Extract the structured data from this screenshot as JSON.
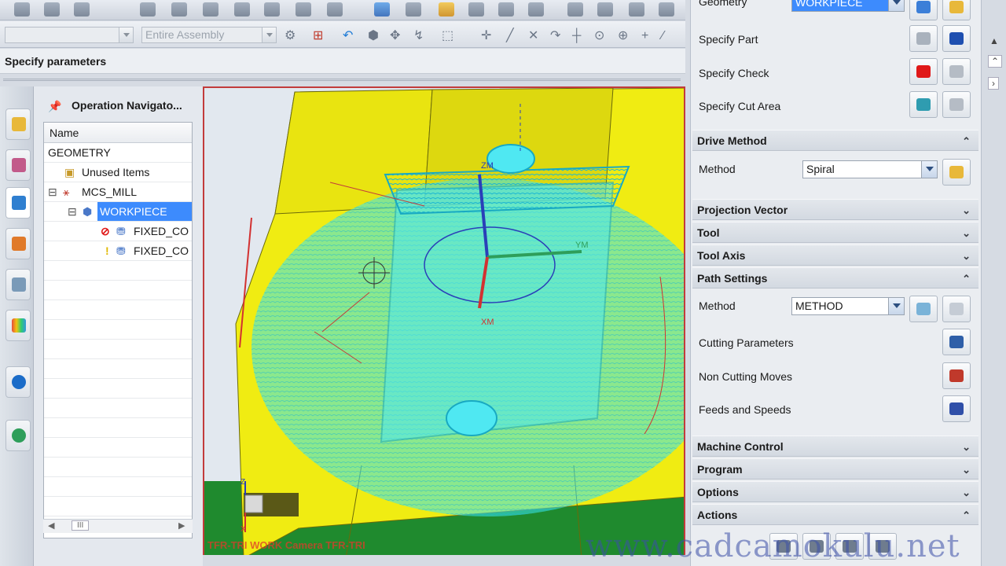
{
  "toolbar": {
    "type_filter_value": "",
    "scope_filter_value": "Entire Assembly"
  },
  "cue_line": "Specify parameters",
  "navigator": {
    "title": "Operation Navigato...",
    "column_header": "Name",
    "rows": [
      {
        "label": "GEOMETRY"
      },
      {
        "label": "Unused Items"
      },
      {
        "label": "MCS_MILL",
        "expand": "⊟"
      },
      {
        "label": "WORKPIECE",
        "expand": "⊟",
        "selected": true
      },
      {
        "label": "FIXED_CO",
        "status": "⊘"
      },
      {
        "label": "FIXED_CO",
        "status": "!"
      }
    ],
    "scroll_grip": "III"
  },
  "viewport": {
    "axis_labels": {
      "zm": "ZM",
      "ym": "YM",
      "xm": "XM"
    },
    "triad_labels": {
      "z": "Z",
      "x": "X"
    },
    "overlay_text": "TFR-TRI WORK Camera TFR-TRI",
    "colors": {
      "part": "#f0ec12",
      "toolpath": "#38e6f2",
      "background": "#e2e8ef",
      "floor": "#1f8a2e"
    }
  },
  "dialog": {
    "geometry_label": "Geometry",
    "geometry_value": "WORKPIECE",
    "specify_part": "Specify Part",
    "specify_check": "Specify Check",
    "specify_cut_area": "Specify Cut Area",
    "sections": {
      "drive_method": "Drive Method",
      "projection_vector": "Projection Vector",
      "tool": "Tool",
      "tool_axis": "Tool Axis",
      "path_settings": "Path Settings",
      "machine_control": "Machine Control",
      "program": "Program",
      "options": "Options",
      "actions": "Actions"
    },
    "drive_method_label": "Method",
    "drive_method_value": "Spiral",
    "path_method_label": "Method",
    "path_method_value": "METHOD",
    "cutting_parameters": "Cutting Parameters",
    "non_cutting_moves": "Non Cutting Moves",
    "feeds_and_speeds": "Feeds and Speeds"
  },
  "watermark": "www.cadcamokulu.net"
}
